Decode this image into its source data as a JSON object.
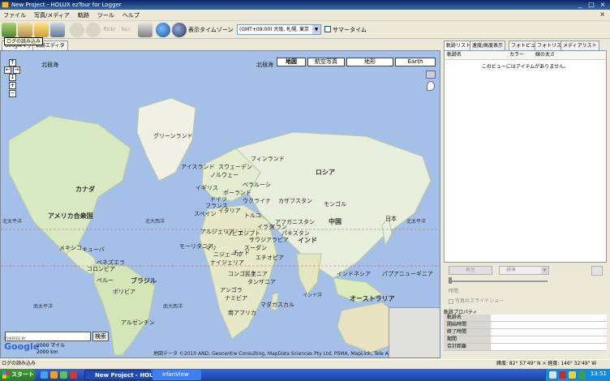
{
  "window": {
    "title": "New Project - HOLUX ezTour for Logger"
  },
  "menu": [
    "ファイル",
    "写真/メディア",
    "軌跡",
    "ツール",
    "ヘルプ"
  ],
  "toolbar": {
    "timezone_label": "表示タイムゾーン",
    "timezone_value": "(GMT+09:00) 大阪, 札幌, 東京",
    "dst_label": "サマータイム",
    "tooltip": "ログの読み込み",
    "icons": [
      "load-log-icon",
      "device-icon",
      "folder-open-icon",
      "photo-icon",
      "back-icon",
      "forward-icon",
      "flickr-icon",
      "locr-icon",
      "print-icon",
      "google-earth-icon",
      "export-icon"
    ],
    "icon_texts": {
      "flickr": "flickr",
      "locr": "locr"
    }
  },
  "left_tabs": [
    "Googleマップ",
    "軌跡エディタ"
  ],
  "map": {
    "types": [
      "地図",
      "航空写真",
      "地形",
      "Earth"
    ],
    "active_type": "地図",
    "countries": [
      {
        "label": "北極海",
        "big": false
      },
      {
        "label": "北極海",
        "big": false
      },
      {
        "label": "グリーンランド",
        "big": false
      },
      {
        "label": "フィンランド",
        "big": false
      },
      {
        "label": "スウェーデン",
        "big": false
      },
      {
        "label": "アイスランド",
        "big": false
      },
      {
        "label": "ノルウェー",
        "big": false
      },
      {
        "label": "イギリス",
        "big": false
      },
      {
        "label": "ベラルーシ",
        "big": false
      },
      {
        "label": "ポーランド",
        "big": false
      },
      {
        "label": "ドイツ",
        "big": false
      },
      {
        "label": "フランス",
        "big": false
      },
      {
        "label": "ウクライナ",
        "big": false
      },
      {
        "label": "スペイン",
        "big": false
      },
      {
        "label": "イタリア",
        "big": false
      },
      {
        "label": "トルコ",
        "big": false
      },
      {
        "label": "ロシア",
        "big": true
      },
      {
        "label": "カザフスタン",
        "big": false
      },
      {
        "label": "モンゴル",
        "big": false
      },
      {
        "label": "カナダ",
        "big": true
      },
      {
        "label": "アメリカ合衆国",
        "big": true
      },
      {
        "label": "中国",
        "big": true
      },
      {
        "label": "日本",
        "big": false
      },
      {
        "label": "イラク",
        "big": false
      },
      {
        "label": "イラン",
        "big": false
      },
      {
        "label": "アフガニスタン",
        "big": false
      },
      {
        "label": "パキスタン",
        "big": false
      },
      {
        "label": "インド",
        "big": true
      },
      {
        "label": "アルジェリア",
        "big": false
      },
      {
        "label": "リビア",
        "big": false
      },
      {
        "label": "エジプト",
        "big": false
      },
      {
        "label": "サウジアラビア",
        "big": false
      },
      {
        "label": "モーリタニア",
        "big": false
      },
      {
        "label": "マリ",
        "big": false
      },
      {
        "label": "ニジェール",
        "big": false
      },
      {
        "label": "チャド",
        "big": false
      },
      {
        "label": "スーダン",
        "big": false
      },
      {
        "label": "ナイジェリア",
        "big": false
      },
      {
        "label": "エチオピア",
        "big": false
      },
      {
        "label": "メキシコ",
        "big": false
      },
      {
        "label": "キューバ",
        "big": false
      },
      {
        "label": "ベネズエラ",
        "big": false
      },
      {
        "label": "コロンビア",
        "big": false
      },
      {
        "label": "ブラジル",
        "big": true
      },
      {
        "label": "ペルー",
        "big": false
      },
      {
        "label": "ボリビア",
        "big": false
      },
      {
        "label": "アルゼンチン",
        "big": false
      },
      {
        "label": "コンゴ民主",
        "big": false
      },
      {
        "label": "ケニア",
        "big": false
      },
      {
        "label": "タンザニア",
        "big": false
      },
      {
        "label": "アンゴラ",
        "big": false
      },
      {
        "label": "ナミビア",
        "big": false
      },
      {
        "label": "南アフリカ",
        "big": false
      },
      {
        "label": "マダガスカル",
        "big": false
      },
      {
        "label": "インドネシア",
        "big": false
      },
      {
        "label": "パプアニューギニア",
        "big": false
      },
      {
        "label": "オーストラリア",
        "big": true
      }
    ],
    "oceans": [
      {
        "label": "北太平洋"
      },
      {
        "label": "北大西洋"
      },
      {
        "label": "北太平洋"
      },
      {
        "label": "南太平洋"
      },
      {
        "label": "南大西洋"
      },
      {
        "label": "インド洋"
      }
    ],
    "copyright": "地図データ ©2010 AND, Geocentre Consulting, MapData Sciences Pty Ltd, PSMA, MapLink, Tele Atlas - 利用規約",
    "powered_by": "POWERED BY",
    "logo": "Google",
    "scale_mi": "2000 マイル",
    "scale_km": "2000 km",
    "search_button": "検索",
    "search_value": ""
  },
  "right_panel": {
    "tabs": [
      "軌跡リスト",
      "速度/高度表示",
      "フォトビュー",
      "フォトリスト",
      "メディアリスト"
    ],
    "active_tab": "軌跡リスト",
    "columns": [
      "軌跡名",
      "カラー",
      "線の太さ"
    ],
    "empty_message": "このビューにはアイテムがありません。",
    "play_button": "再生",
    "speed_value": "標準",
    "time_label": "時間",
    "photo_slideshow": "写真のスライドショー",
    "properties_title": "軌跡プロパティ",
    "properties": [
      "軌跡名",
      "開始時間",
      "終了時間",
      "期間",
      "合計距離"
    ]
  },
  "status": {
    "left": "ログの読み込み",
    "coords": "緯度: 82° 57'49\" N × 経度: 146° 32'49\" W"
  },
  "taskbar": {
    "start": "スタート",
    "tasks": [
      "New Project - HOLU...",
      "IrfanView"
    ],
    "clock": "13:51"
  }
}
